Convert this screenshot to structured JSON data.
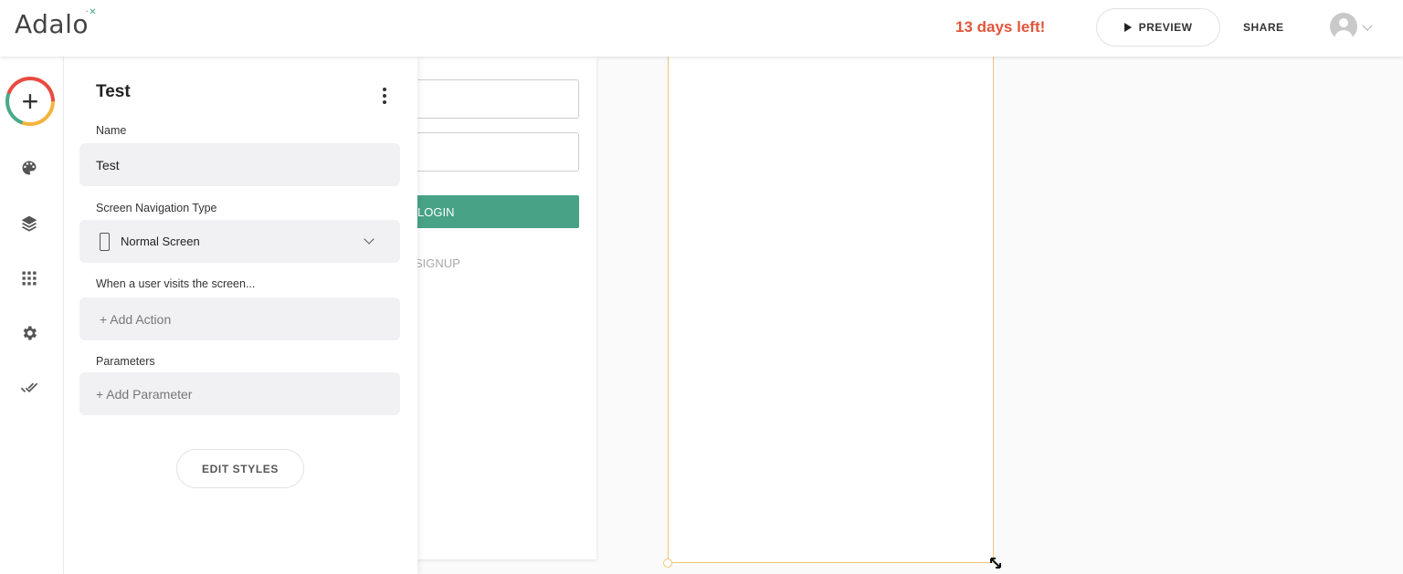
{
  "app": {
    "logo": "Adalo"
  },
  "topbar": {
    "trial": "13 days left!",
    "preview_label": "PREVIEW",
    "share_label": "SHARE"
  },
  "rail": {
    "icons": [
      "palette-icon",
      "layers-icon",
      "grid-icon",
      "gear-icon",
      "double-check-icon"
    ]
  },
  "panel": {
    "title": "Test",
    "name_label": "Name",
    "name_value": "Test",
    "nav_type_label": "Screen Navigation Type",
    "nav_type_value": "Normal Screen",
    "visit_label": "When a user visits the screen...",
    "add_action": "+ Add Action",
    "params_label": "Parameters",
    "add_param": "+ Add Parameter",
    "edit_styles": "EDIT STYLES"
  },
  "canvas": {
    "login_label": "LOGIN",
    "signup_label": "SIGNUP"
  },
  "colors": {
    "accent_green": "#47a286",
    "trial_red": "#e2553b",
    "selection": "#f0c476"
  }
}
